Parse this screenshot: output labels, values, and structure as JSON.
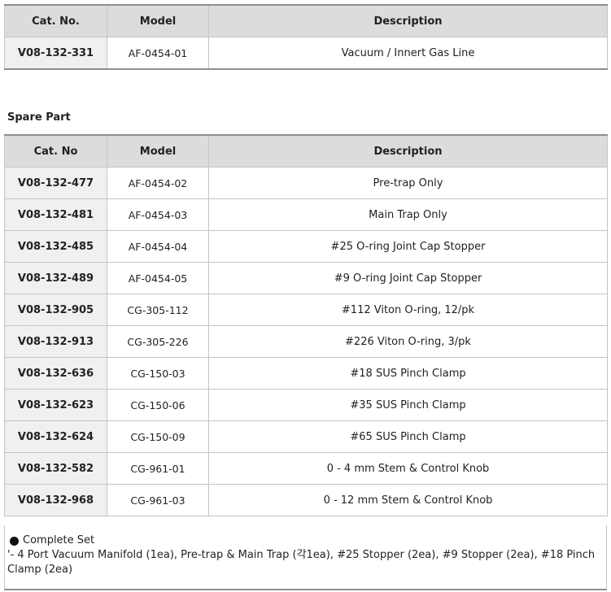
{
  "main_table": {
    "headers": [
      "Cat. No.",
      "Model",
      "Description"
    ],
    "rows": [
      {
        "cat_no": "V08-132-331",
        "model": "AF-0454-01",
        "description": "Vacuum / Innert Gas Line"
      }
    ]
  },
  "spare_part": {
    "title": "Spare Part",
    "headers": [
      "Cat. No",
      "Model",
      "Description"
    ],
    "rows": [
      {
        "cat_no": "V08-132-477",
        "model": "AF-0454-02",
        "description": "Pre-trap Only"
      },
      {
        "cat_no": "V08-132-481",
        "model": "AF-0454-03",
        "description": "Main Trap Only"
      },
      {
        "cat_no": "V08-132-485",
        "model": "AF-0454-04",
        "description": "#25 O-ring Joint Cap Stopper"
      },
      {
        "cat_no": "V08-132-489",
        "model": "AF-0454-05",
        "description": "#9 O-ring Joint Cap Stopper"
      },
      {
        "cat_no": "V08-132-905",
        "model": "CG-305-112",
        "description": "#112 Viton O-ring, 12/pk"
      },
      {
        "cat_no": "V08-132-913",
        "model": "CG-305-226",
        "description": "#226 Viton O-ring, 3/pk"
      },
      {
        "cat_no": "V08-132-636",
        "model": "CG-150-03",
        "description": "#18 SUS Pinch Clamp"
      },
      {
        "cat_no": "V08-132-623",
        "model": "CG-150-06",
        "description": "#35 SUS Pinch Clamp"
      },
      {
        "cat_no": "V08-132-624",
        "model": "CG-150-09",
        "description": "#65 SUS Pinch Clamp"
      },
      {
        "cat_no": "V08-132-582",
        "model": "CG-961-01",
        "description": "0 - 4 mm Stem & Control Knob"
      },
      {
        "cat_no": "V08-132-968",
        "model": "CG-961-03",
        "description": "0 - 12 mm Stem & Control Knob"
      }
    ]
  },
  "note": {
    "heading": "Complete Set",
    "bullet_icon": "black-circle-icon",
    "text": "'- 4 Port Vacuum Manifold (1ea), Pre-trap & Main Trap (각1ea), #25 Stopper (2ea), #9 Stopper (2ea), #18 Pinch Clamp (2ea)"
  }
}
